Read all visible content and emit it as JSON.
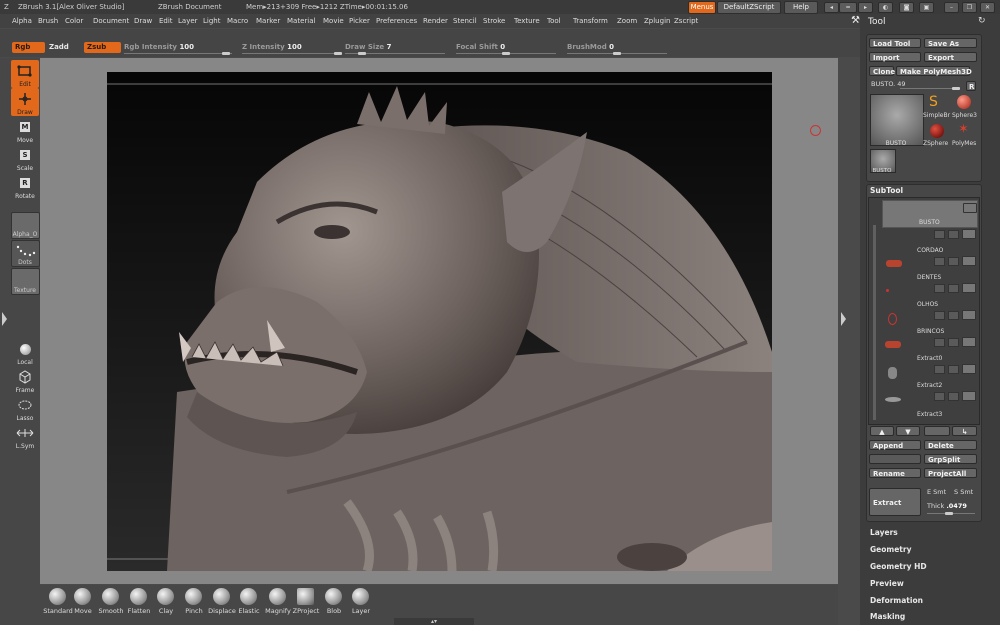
{
  "titlebar": {
    "app": "ZBrush  3.1[Alex Oliver Studio]",
    "document": "ZBrush Document",
    "stats": "Mem▸213+309 Free▸1212 ZTime▸00:01:15.06",
    "menus_button": "Menus",
    "default_zscript": "DefaultZScript",
    "help": "Help"
  },
  "menus": [
    "Alpha",
    "Brush",
    "Color",
    "Document",
    "Draw",
    "Edit",
    "Layer",
    "Light",
    "Macro",
    "Marker",
    "Material",
    "Movie",
    "Picker",
    "Preferences",
    "Render",
    "Stencil",
    "Stroke",
    "Texture",
    "Tool",
    "Transform",
    "Zoom",
    "Zplugin",
    "Zscript"
  ],
  "toolbar": {
    "rgb": "Rgb",
    "zadd": "Zadd",
    "zsub": "Zsub",
    "rgb_intensity_label": "Rgb Intensity",
    "rgb_intensity_value": "100",
    "z_intensity_label": "Z Intensity",
    "z_intensity_value": "100",
    "draw_size_label": "Draw Size",
    "draw_size_value": "7",
    "focal_shift_label": "Focal Shift",
    "focal_shift_value": "0",
    "brushmod_label": "BrushMod",
    "brushmod_value": "0"
  },
  "left_shelf": {
    "edit": "Edit",
    "draw": "Draw",
    "move": "Move",
    "scale": "Scale",
    "rotate": "Rotate",
    "alpha": "Alpha_O",
    "dots": "Dots",
    "texture": "Texture",
    "local": "Local",
    "frame": "Frame",
    "lasso": "Lasso",
    "lsym": "L.Sym"
  },
  "brushes": [
    "Standard",
    "Move",
    "Smooth",
    "Flatten",
    "Clay",
    "Pinch",
    "Displace",
    "Elastic",
    "Magnify",
    "ZProject",
    "Blob",
    "Layer"
  ],
  "tool": {
    "title": "Tool",
    "load_tool": "Load Tool",
    "save_as": "Save As",
    "import": "Import",
    "export": "Export",
    "clone": "Clone",
    "make_polymesh": "Make PolyMesh3D",
    "current_label": "BUSTO. 49",
    "r_button": "R",
    "thumbs": [
      "BUSTO",
      "SimpleBr",
      "Sphere3",
      "ZSphere",
      "PolyMes",
      "BUSTO"
    ]
  },
  "subtool": {
    "title": "SubTool",
    "items": [
      "BUSTO",
      "CORDAO",
      "DENTES",
      "OLHOS",
      "BRINCOS",
      "Extract0",
      "Extract2",
      "Extract3"
    ],
    "append": "Append",
    "delete": "Delete",
    "grpsplit": "GrpSplit",
    "rename": "Rename",
    "projectall": "ProjectAll",
    "extract": "Extract",
    "e_smt": "E Smt",
    "s_smt": "S Smt",
    "thick_label": "Thick",
    "thick_value": ".0479"
  },
  "sections": [
    "Layers",
    "Geometry",
    "Geometry HD",
    "Preview",
    "Deformation",
    "Masking"
  ],
  "colors": {
    "accent": "#e2691c",
    "background": "#4a4a4a",
    "panel": "#3c3c3c"
  }
}
